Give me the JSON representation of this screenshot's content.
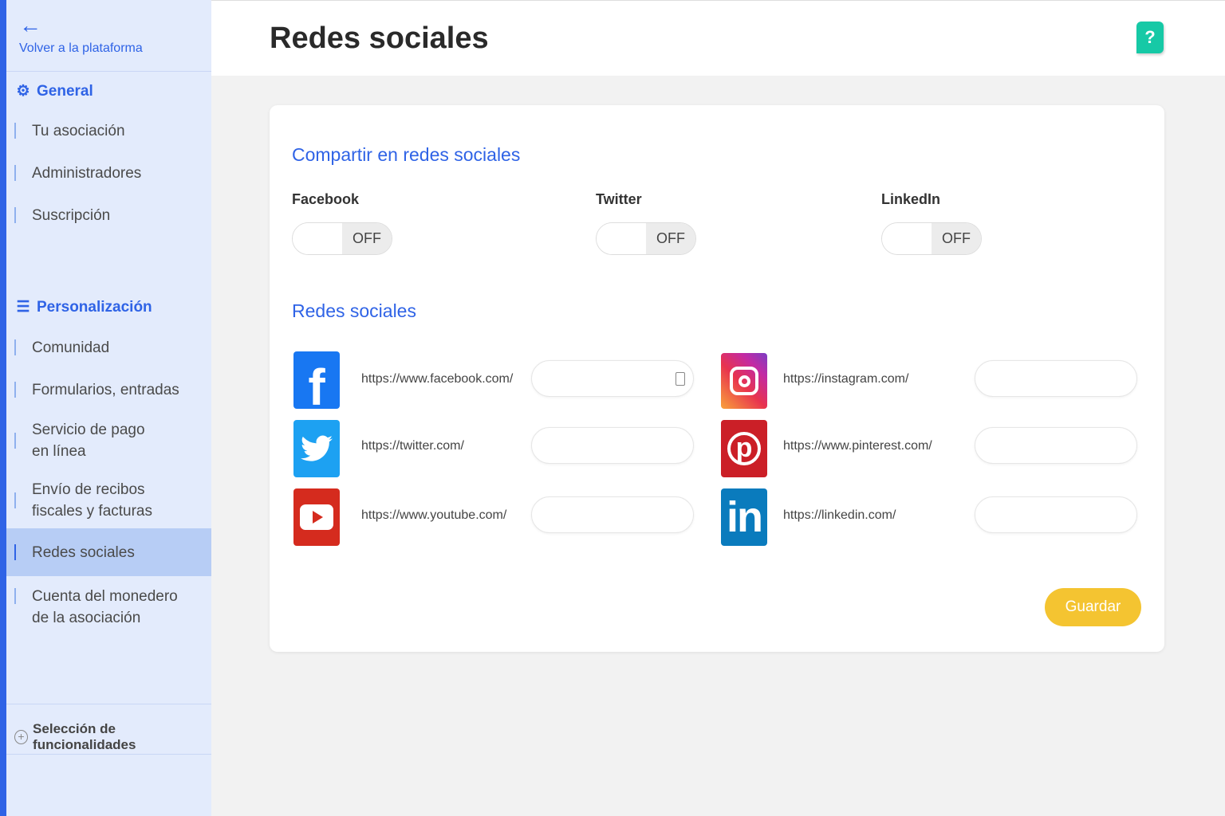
{
  "sidebar": {
    "back_label": "Volver a la plataforma",
    "general": {
      "title": "General",
      "items": [
        "Tu asociación",
        "Administradores",
        "Suscripción"
      ]
    },
    "personalization": {
      "title": "Personalización",
      "items": [
        "Comunidad",
        "Formularios, entradas",
        "Servicio de pago en línea",
        "Envío de recibos fiscales y facturas",
        "Redes sociales",
        "Cuenta del monedero de la asociación"
      ],
      "active": "Redes sociales"
    },
    "features_label": "Selección de funcionalidades"
  },
  "header": {
    "title": "Redes sociales",
    "help_label": "?"
  },
  "share": {
    "title": "Compartir en redes sociales",
    "toggles": [
      {
        "label": "Facebook",
        "state": "OFF"
      },
      {
        "label": "Twitter",
        "state": "OFF"
      },
      {
        "label": "LinkedIn",
        "state": "OFF"
      }
    ]
  },
  "networks": {
    "title": "Redes sociales",
    "items": [
      {
        "name": "facebook",
        "url": "https://www.facebook.com/",
        "value": ""
      },
      {
        "name": "instagram",
        "url": "https://instagram.com/",
        "value": ""
      },
      {
        "name": "twitter",
        "url": "https://twitter.com/",
        "value": ""
      },
      {
        "name": "pinterest",
        "url": "https://www.pinterest.com/",
        "value": ""
      },
      {
        "name": "youtube",
        "url": "https://www.youtube.com/",
        "value": ""
      },
      {
        "name": "linkedin",
        "url": "https://linkedin.com/",
        "value": ""
      }
    ]
  },
  "save_label": "Guardar",
  "colors": {
    "accent": "#2f63e6",
    "save": "#f4c431",
    "help": "#16c9a6",
    "facebook": "#1877f2",
    "twitter": "#1da1f2",
    "youtube": "#d52b1e",
    "instagram": "#d6249f",
    "pinterest": "#cb1f27",
    "linkedin": "#0a7bbd"
  }
}
